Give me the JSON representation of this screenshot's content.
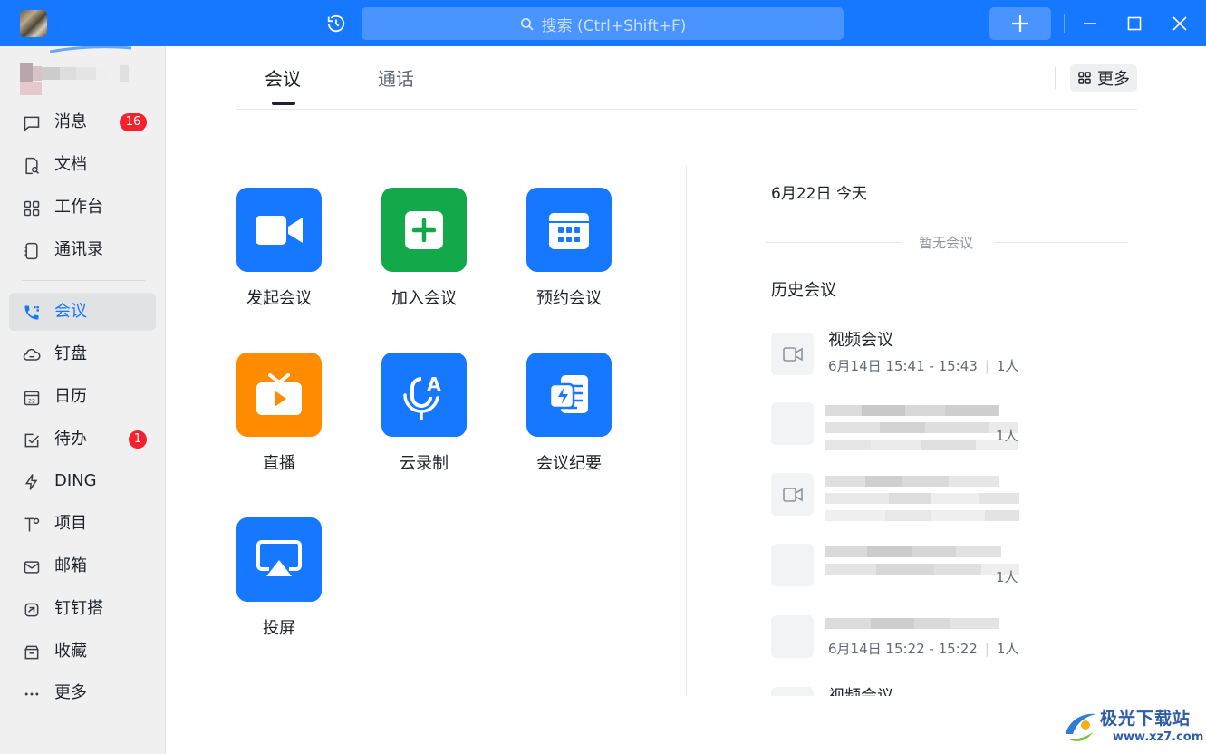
{
  "titlebar": {
    "search_placeholder": "搜索 (Ctrl+Shift+F)"
  },
  "sidebar": {
    "items": [
      {
        "label": "消息",
        "icon": "chat-icon",
        "badge": "16"
      },
      {
        "label": "文档",
        "icon": "document-icon"
      },
      {
        "label": "工作台",
        "icon": "grid-icon"
      },
      {
        "label": "通讯录",
        "icon": "contacts-icon"
      },
      {
        "label": "会议",
        "icon": "phone-icon",
        "active": true
      },
      {
        "label": "钉盘",
        "icon": "cloud-drive-icon"
      },
      {
        "label": "日历",
        "icon": "calendar-icon"
      },
      {
        "label": "待办",
        "icon": "todo-icon",
        "badge": "1"
      },
      {
        "label": "DING",
        "icon": "lightning-icon"
      },
      {
        "label": "项目",
        "icon": "project-icon"
      },
      {
        "label": "邮箱",
        "icon": "mail-icon"
      },
      {
        "label": "钉钉搭",
        "icon": "builder-icon"
      },
      {
        "label": "收藏",
        "icon": "favorites-icon"
      },
      {
        "label": "更多",
        "icon": "more-dots-icon"
      }
    ]
  },
  "main": {
    "tabs": [
      {
        "label": "会议",
        "active": true
      },
      {
        "label": "通话",
        "active": false
      }
    ],
    "more_label": "更多",
    "actions": [
      {
        "label": "发起会议",
        "icon": "video-camera-icon",
        "color": "#1677ff"
      },
      {
        "label": "加入会议",
        "icon": "plus-square-icon",
        "color": "#13a84a"
      },
      {
        "label": "预约会议",
        "icon": "calendar-grid-icon",
        "color": "#1677ff"
      },
      {
        "label": "直播",
        "icon": "tv-play-icon",
        "color": "#ff8c00"
      },
      {
        "label": "云录制",
        "icon": "mic-translate-icon",
        "color": "#1677ff"
      },
      {
        "label": "会议纪要",
        "icon": "ai-notes-icon",
        "color": "#1677ff"
      },
      {
        "label": "投屏",
        "icon": "screen-cast-icon",
        "color": "#1677ff"
      }
    ]
  },
  "right_panel": {
    "date": "6月22日 今天",
    "empty_text": "暂无会议",
    "history_title": "历史会议",
    "history": [
      {
        "title": "视频会议",
        "time": "6月14日 15:41 - 15:43",
        "people": "1人"
      },
      {
        "people": "1人"
      },
      {},
      {
        "people": "1人"
      },
      {
        "time": "6月14日 15:22 - 15:22",
        "people": "1人"
      },
      {
        "title": "视频会议"
      }
    ]
  },
  "watermark": {
    "text": "极光下载站",
    "url": "www.xz7.com"
  }
}
